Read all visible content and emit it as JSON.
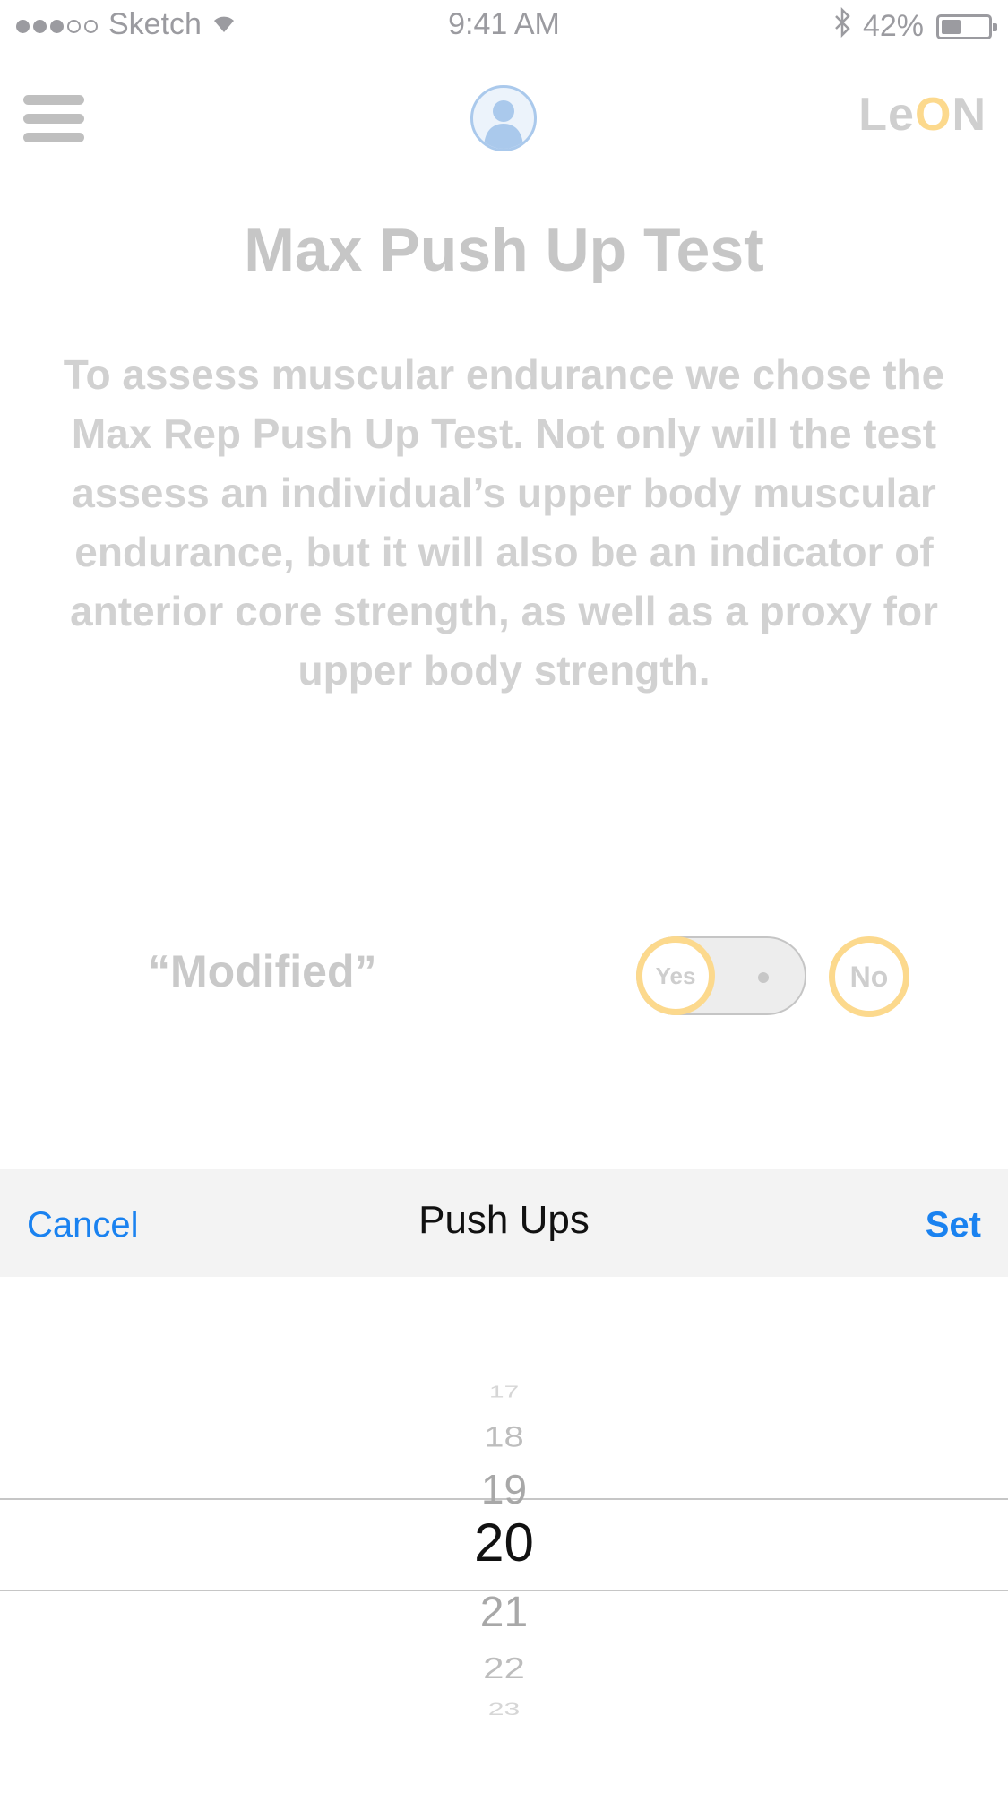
{
  "status": {
    "carrier": "Sketch",
    "time": "9:41 AM",
    "battery_percent": "42%",
    "battery_level": 0.42,
    "signal": {
      "filled": 3,
      "total": 5
    }
  },
  "nav": {
    "logo": "LeON",
    "menu_icon": "hamburger-icon",
    "profile_icon": "user-avatar-icon"
  },
  "page": {
    "title": "Max Push Up Test",
    "description": "To assess muscular endurance we chose the Max Rep Push Up Test. Not only will the test assess an individual’s upper body muscular endurance, but it will also be an indicator of anterior core strength, as well as a proxy for upper body strength."
  },
  "modified": {
    "label": "“Modified”",
    "yes_label": "Yes",
    "no_label": "No",
    "selected": "Yes"
  },
  "picker": {
    "cancel_label": "Cancel",
    "title": "Push Ups",
    "set_label": "Set",
    "values": [
      "17",
      "18",
      "19",
      "20",
      "21",
      "22",
      "23"
    ],
    "selected": "20"
  },
  "colors": {
    "accent_blue": "#1a82f0",
    "toggle_ring": "#fcd47e",
    "muted_text": "#c8c8c8"
  }
}
